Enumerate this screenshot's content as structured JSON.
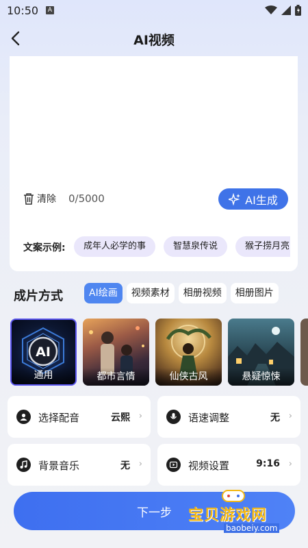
{
  "status_bar": {
    "time": "10:50",
    "notification_badge": "A"
  },
  "header": {
    "title": "AI视频",
    "back_icon": "chevron-left-icon"
  },
  "editor": {
    "clear_label": "清除",
    "char_count": "0/5000",
    "ai_generate_label": "AI生成",
    "examples_label": "文案示例:",
    "examples": [
      "成年人必学的事",
      "智慧泉传说",
      "猴子捞月亮"
    ]
  },
  "method": {
    "label": "成片方式",
    "tabs": [
      {
        "label": "AI绘画",
        "active": true
      },
      {
        "label": "视频素材",
        "active": false
      },
      {
        "label": "相册视频",
        "active": false
      },
      {
        "label": "相册图片",
        "active": false
      }
    ]
  },
  "styles": [
    {
      "name": "通用",
      "selected": true,
      "badge": "AI"
    },
    {
      "name": "都市言情",
      "selected": false
    },
    {
      "name": "仙侠古风",
      "selected": false
    },
    {
      "name": "悬疑惊悚",
      "selected": false
    }
  ],
  "settings": [
    {
      "label": "选择配音",
      "value": "云熙",
      "icon": "user-voice-icon"
    },
    {
      "label": "语速调整",
      "value": "无",
      "icon": "microphone-icon"
    },
    {
      "label": "背景音乐",
      "value": "无",
      "icon": "music-note-icon"
    },
    {
      "label": "视频设置",
      "value": "9:16",
      "icon": "video-play-icon"
    }
  ],
  "footer": {
    "next_label": "下一步"
  },
  "watermark": {
    "text": "宝贝游戏网",
    "url": "baobeiy.com"
  },
  "colors": {
    "accent": "#3f73e8",
    "chip_bg": "#eae7fb",
    "selected_border": "#5a55ef"
  }
}
